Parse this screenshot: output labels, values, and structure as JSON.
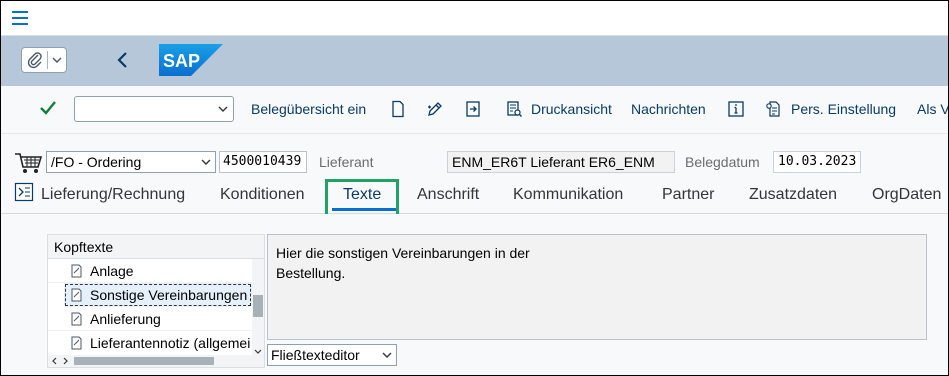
{
  "toolbar": {
    "items": {
      "overview": "Belegübersicht ein",
      "print_preview": "Druckansicht",
      "messages": "Nachrichten",
      "personal_settings": "Pers. Einstellung",
      "more": "Als V"
    }
  },
  "header": {
    "order_type": "/FO - Ordering",
    "po_number": "4500010439",
    "vendor_label": "Lieferant",
    "vendor_value": "ENM_ER6T Lieferant ER6_ENM",
    "doc_date_label": "Belegdatum",
    "doc_date_value": "10.03.2023"
  },
  "tabs": [
    {
      "label": "Lieferung/Rechnung"
    },
    {
      "label": "Konditionen"
    },
    {
      "label": "Texte"
    },
    {
      "label": "Anschrift"
    },
    {
      "label": "Kommunikation"
    },
    {
      "label": "Partner"
    },
    {
      "label": "Zusatzdaten"
    },
    {
      "label": "OrgDaten"
    }
  ],
  "texts": {
    "tree_header": "Kopftexte",
    "items": [
      {
        "label": "Anlage"
      },
      {
        "label": "Sonstige Vereinbarungen"
      },
      {
        "label": "Anlieferung"
      },
      {
        "label": "Lieferantennotiz (allgemei"
      }
    ],
    "editor_line1": "Hier die sonstigen Vereinbarungen in der",
    "editor_line2": "Bestellung.",
    "editor_mode": "Fließtexteditor"
  },
  "colors": {
    "accent": "#0a6ed1",
    "shell": "#b5c7d9",
    "highlight": "#21a366"
  }
}
